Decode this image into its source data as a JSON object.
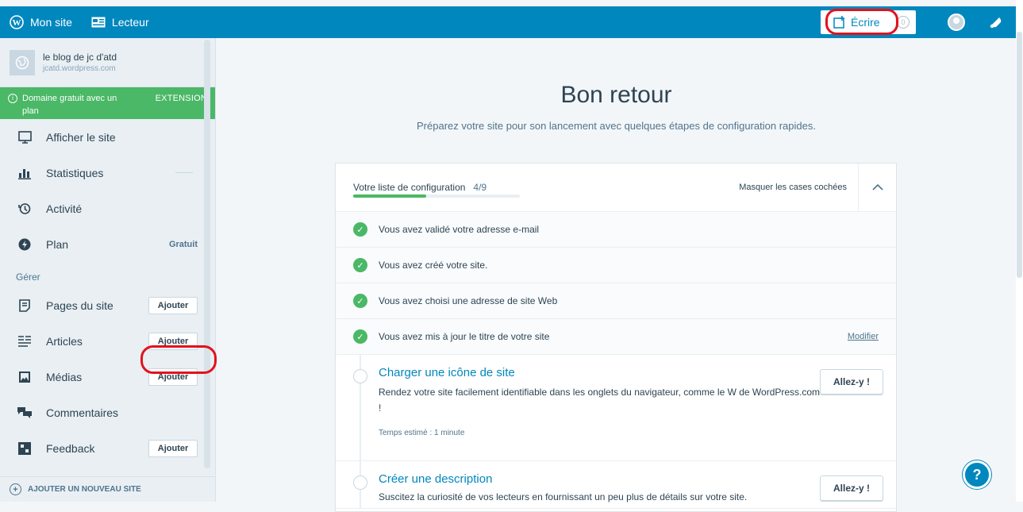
{
  "topbar": {
    "my_site": "Mon site",
    "reader": "Lecteur",
    "write": "Écrire"
  },
  "sidebar": {
    "site_name": "le blog de jc d'atd",
    "site_url": "jcatd.wordpress.com",
    "promo_text": "Domaine gratuit avec un plan",
    "promo_action": "EXTENSION",
    "items": [
      {
        "label": "Afficher le site"
      },
      {
        "label": "Statistiques"
      },
      {
        "label": "Activité"
      },
      {
        "label": "Plan",
        "side": "Gratuit"
      }
    ],
    "group_label": "Gérer",
    "manage_items": [
      {
        "label": "Pages du site",
        "action": "Ajouter"
      },
      {
        "label": "Articles",
        "action": "Ajouter"
      },
      {
        "label": "Médias",
        "action": "Ajouter"
      },
      {
        "label": "Commentaires"
      },
      {
        "label": "Feedback",
        "action": "Ajouter"
      }
    ],
    "add_site": "AJOUTER UN NOUVEAU SITE"
  },
  "main": {
    "title": "Bon retour",
    "subtitle": "Préparez votre site pour son lancement avec quelques étapes de configuration rapides.",
    "checklist": {
      "title": "Votre liste de configuration",
      "count": "4/9",
      "progress": 0.44,
      "hide_label": "Masquer les cases cochées",
      "done": [
        {
          "label": "Vous avez validé votre adresse e-mail"
        },
        {
          "label": "Vous avez créé votre site."
        },
        {
          "label": "Vous avez choisi une adresse de site Web"
        },
        {
          "label": "Vous avez mis à jour le titre de votre site",
          "link": "Modifier"
        }
      ],
      "tasks": [
        {
          "title": "Charger une icône de site",
          "desc": "Rendez votre site facilement identifiable dans les onglets du navigateur, comme le W de WordPress.com !",
          "time": "Temps estimé : 1 minute",
          "button": "Allez-y !"
        },
        {
          "title": "Créer une description",
          "desc": "Suscitez la curiosité de vos lecteurs en fournissant un peu plus de détails sur votre site.",
          "button": "Allez-y !"
        }
      ]
    }
  },
  "colors": {
    "brand": "#0087be",
    "success": "#4ab866",
    "annotation": "#e2121c"
  }
}
